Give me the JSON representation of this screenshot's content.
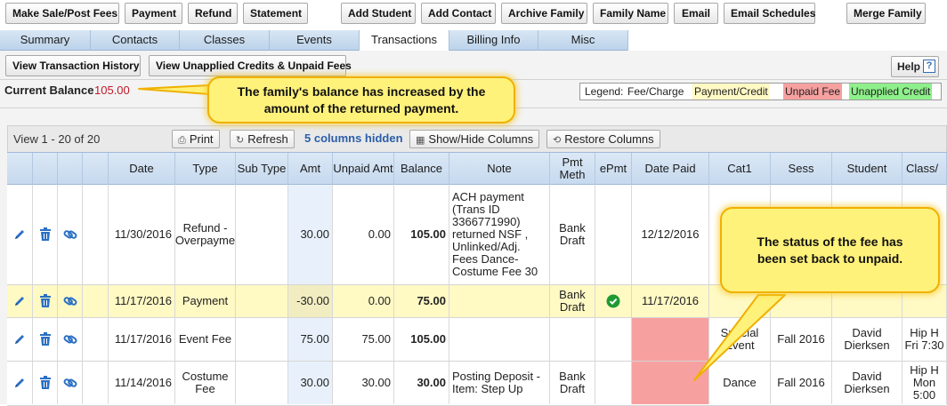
{
  "toolbar": {
    "make_sale": "Make Sale/Post Fees",
    "payment": "Payment",
    "refund": "Refund",
    "statement": "Statement",
    "add_student": "Add Student",
    "add_contact": "Add Contact",
    "archive_family": "Archive Family",
    "family_name": "Family Name",
    "email": "Email",
    "email_schedules": "Email Schedules",
    "merge_family": "Merge Family"
  },
  "tabs": [
    "Summary",
    "Contacts",
    "Classes",
    "Events",
    "Transactions",
    "Billing Info",
    "Misc"
  ],
  "active_tab": "Transactions",
  "subtoolbar": {
    "view_history": "View Transaction History",
    "view_unapplied": "View Unapplied Credits & Unpaid Fees",
    "help": "Help",
    "help_q": "?"
  },
  "balance": {
    "label": "Current Balance",
    "value": "105.00"
  },
  "legend": {
    "prefix": "Legend:",
    "fee": "Fee/Charge",
    "payment": "Payment/Credit",
    "unpaid": "Unpaid Fee",
    "unapplied": "Unapplied Credit",
    "colors": {
      "payment": "#fff9c4",
      "unpaid": "#f7a0a0",
      "unapplied": "#8ef08a"
    }
  },
  "grid_toolbar": {
    "view_range": "View 1 - 20 of 20",
    "print": "Print",
    "refresh": "Refresh",
    "hidden": "5 columns hidden",
    "show_hide": "Show/Hide Columns",
    "restore": "Restore Columns"
  },
  "columns": [
    "Date",
    "Type",
    "Sub Type",
    "Amt",
    "Unpaid Amt",
    "Balance",
    "Note",
    "Pmt Meth",
    "ePmt",
    "Date Paid",
    "Cat1",
    "Sess",
    "Student",
    "Class/"
  ],
  "rows": [
    {
      "date": "11/30/2016",
      "type": "Refund - Overpayme",
      "sub_type": "",
      "amt": "30.00",
      "unpaid": "0.00",
      "balance": "105.00",
      "note": "ACH payment (Trans ID 3366771990) returned NSF , Unlinked/Adj. Fees Dance-Costume Fee 30",
      "pmt_meth": "Bank Draft",
      "epmt": "",
      "date_paid": "12/12/2016",
      "cat1": "",
      "sess": "",
      "student": "",
      "class": ""
    },
    {
      "date": "11/17/2016",
      "type": "Payment",
      "sub_type": "",
      "amt": "-30.00",
      "unpaid": "0.00",
      "balance": "75.00",
      "note": "",
      "pmt_meth": "Bank Draft",
      "epmt": "check",
      "date_paid": "11/17/2016",
      "cat1": "",
      "sess": "",
      "student": "",
      "class": ""
    },
    {
      "date": "11/17/2016",
      "type": "Event Fee",
      "sub_type": "",
      "amt": "75.00",
      "unpaid": "75.00",
      "balance": "105.00",
      "note": "",
      "pmt_meth": "",
      "epmt": "",
      "date_paid": "",
      "cat1": "Special Event",
      "sess": "Fall 2016",
      "student": "David Dierksen",
      "class": "Hip H Fri 7:30"
    },
    {
      "date": "11/14/2016",
      "type": "Costume Fee",
      "sub_type": "",
      "amt": "30.00",
      "unpaid": "30.00",
      "balance": "30.00",
      "note": "Posting Deposit - Item: Step Up",
      "pmt_meth": "Bank Draft",
      "epmt": "",
      "date_paid": "",
      "cat1": "Dance",
      "sess": "Fall 2016",
      "student": "David Dierksen",
      "class": "Hip H Mon 5:00"
    }
  ],
  "callouts": {
    "balance": "The family's balance has increased by the amount of the returned payment.",
    "status": "The status of the fee has been set back to unpaid."
  },
  "icons": [
    "pencil-icon",
    "trash-icon",
    "link-icon",
    "print-icon",
    "refresh-icon",
    "columns-icon",
    "restore-icon",
    "check-circle-icon",
    "help-icon"
  ]
}
